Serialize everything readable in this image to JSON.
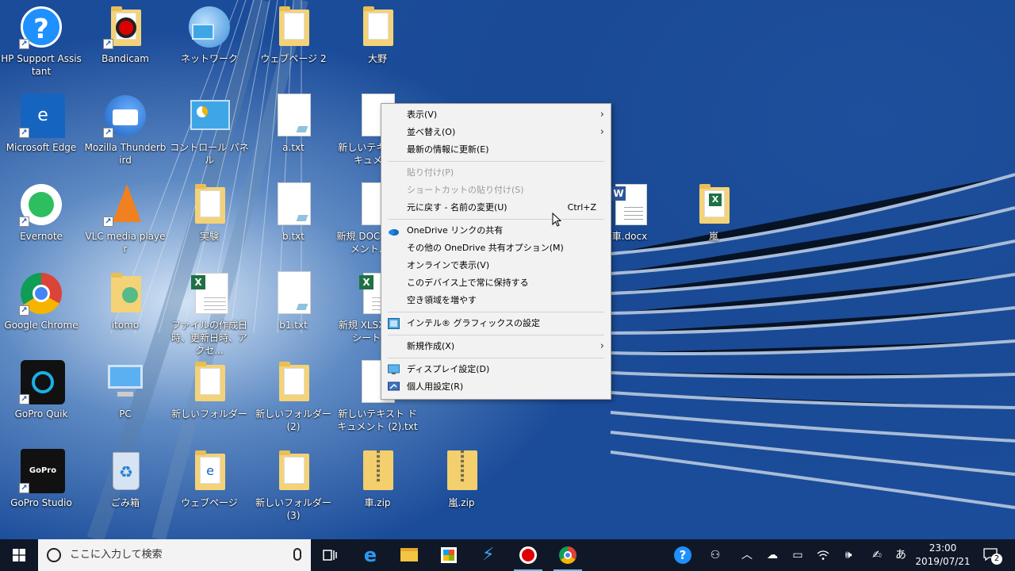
{
  "desktop": {
    "icons": {
      "hp_support": "HP Support Assistant",
      "bandicam": "Bandicam",
      "network": "ネットワーク",
      "webpage2": "ウェブページ 2",
      "ono": "大野",
      "edge": "Microsoft Edge",
      "thunderbird": "Mozilla Thunderbird",
      "control_panel": "コントロール パネル",
      "a_txt": "a.txt",
      "new_text_1": "新しいテキスト ドキュメント",
      "evernote": "Evernote",
      "vlc": "VLC media player",
      "jikken": "実験",
      "b_txt": "b.txt",
      "new_docx": "新規 DOCX ドキュメント.docx",
      "car_docx": "車.docx",
      "arashi": "嵐",
      "chrome": "Google Chrome",
      "itomo": "itomo",
      "file_xlsx": "ファイルの作成日時、更新日時、アクセ...",
      "b1_txt": "b1.txt",
      "new_xlsx": "新規 XLSX ワークシート.xlsx",
      "gopro_quik": "GoPro Quik",
      "pc": "PC",
      "new_folder": "新しいフォルダー",
      "new_folder_2": "新しいフォルダー (2)",
      "new_text_2": "新しいテキスト ドキュメント (2).txt",
      "gopro_studio": "GoPro Studio",
      "trash": "ごみ箱",
      "webpage": "ウェブページ",
      "new_folder_3": "新しいフォルダー (3)",
      "car_zip": "車.zip",
      "arashi_zip": "嵐.zip"
    }
  },
  "context_menu": {
    "view": "表示(V)",
    "sort": "並べ替え(O)",
    "refresh": "最新の情報に更新(E)",
    "paste": "貼り付け(P)",
    "paste_shortcut": "ショートカットの貼り付け(S)",
    "undo": "元に戻す - 名前の変更(U)",
    "undo_shortcut": "Ctrl+Z",
    "onedrive_link": "OneDrive リンクの共有",
    "onedrive_more": "その他の OneDrive 共有オプション(M)",
    "view_online": "オンラインで表示(V)",
    "keep_device": "このデバイス上で常に保持する",
    "free_space": "空き領域を増やす",
    "intel": "インテル® グラフィックスの設定",
    "new": "新規作成(X)",
    "display": "ディスプレイ設定(D)",
    "personalize": "個人用設定(R)"
  },
  "taskbar": {
    "search_placeholder": "ここに入力して検索",
    "time": "23:00",
    "date": "2019/07/21",
    "ime": "あ",
    "notification_count": "2"
  },
  "colors": {
    "taskbar_bg": "#101827",
    "menu_bg": "#f2f2f2",
    "accent": "#76b9ed"
  }
}
